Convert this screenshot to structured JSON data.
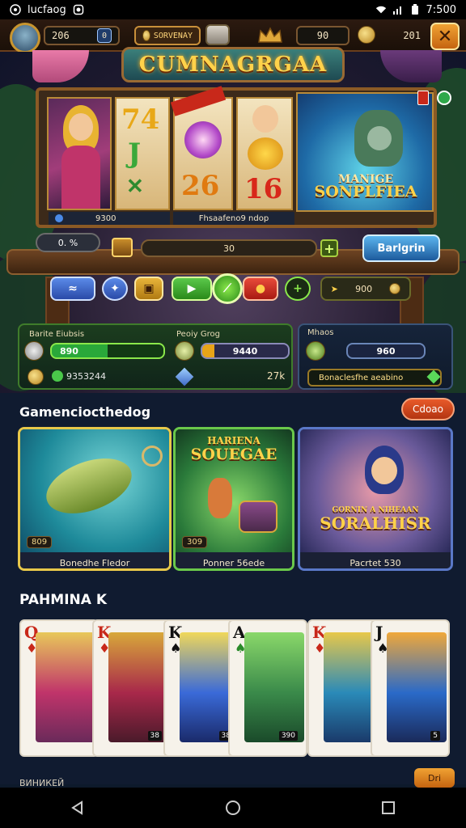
{
  "status_bar": {
    "app_name": "lucfaog",
    "time": "7:500"
  },
  "hud": {
    "level_value": "206",
    "level_badge": "0",
    "currency_label": "SORVENAY",
    "crown_value": "90",
    "coins_value": "201",
    "close_label": "✕"
  },
  "banner": {
    "title": "CUMNAGRGAA",
    "promo_sub": "MANIGE",
    "promo_title": "SONPLFIEA",
    "caption_left": "9300",
    "caption_right": "Fhsaafeno9 ndop",
    "reel_glyphs": [
      "74",
      "J",
      "26",
      "16"
    ],
    "small_pill": "0. %",
    "bet_value": "30",
    "blue_button": "Barlgrin",
    "ctrl_spin_value": "900",
    "ctrl_labels": [
      "≈",
      "✦",
      "▣",
      "▶",
      "⟋",
      "●",
      "+"
    ]
  },
  "stats": {
    "left_label_a": "Barite Eiubsis",
    "left_value_a": "890",
    "left_label_b": "Peoiy Grog",
    "left_value_b": "9440",
    "coins_total": "9353244",
    "level_short": "27k",
    "right_label": "Mhaos",
    "right_value": "960",
    "claim_text": "Bonaclesfhe aeabino"
  },
  "section1": {
    "title": "Gamenciocthedog",
    "more_button": "Cdoao",
    "cards": [
      {
        "caption": "Bonedhe Fledor",
        "tag": "809",
        "title": ""
      },
      {
        "caption": "Ponner 56ede",
        "tag": "309",
        "title": "SOUEGAE",
        "subtitle": "HARIENA"
      },
      {
        "caption": "Pacrtet 530",
        "tag": "",
        "title": "SORALHISR",
        "subtitle": "GORNIN A NIHEAAN"
      }
    ]
  },
  "section2": {
    "title": "PAHMINA K",
    "cards": [
      {
        "rank": "Q",
        "suit": "♦",
        "num": ""
      },
      {
        "rank": "K",
        "suit": "♦",
        "num": "38"
      },
      {
        "rank": "K",
        "suit": "♠",
        "num": "38"
      },
      {
        "rank": "A",
        "suit": "♠",
        "num": "390"
      },
      {
        "rank": "K",
        "suit": "♦",
        "num": ""
      },
      {
        "rank": "J",
        "suit": "♠",
        "num": "5"
      }
    ]
  },
  "peek": {
    "text": "ВИНИКЕЙ",
    "button": "Dri"
  },
  "colors": {
    "gold": "#ffd24a",
    "panel_green": "#3f7c2b",
    "accent_orange": "#e85a2a",
    "accent_blue": "#1d5a9c"
  }
}
